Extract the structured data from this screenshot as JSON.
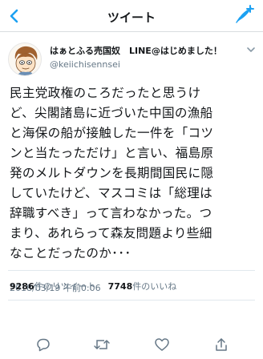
{
  "header": {
    "title": "ツイート"
  },
  "user": {
    "name": "はぁとふる売国奴　LINE@はじめました！",
    "handle": "@keiichisennsei"
  },
  "tweet": {
    "text": "民主党政権のころだったと思うけ\nど、尖閣諸島に近づいた中国の漁船\nと海保の船が接触した一件を「コツ\nンと当たっただけ」と言い、福島原\n発のメルトダウンを長期間国民に隠\nしていたけど、マスコミは「総理は\n辞職すべき」って言わなかった。つ\nまり、あれらって森友問題より些細\nなことだったのか･･･",
    "timestamp": "2018/03/19 午前0:06"
  },
  "stats": {
    "retweets_count": "9286",
    "retweets_label": "件のリツイート",
    "likes_count": "7748",
    "likes_label": "件のいいね"
  },
  "colors": {
    "accent": "#1da1f2",
    "text": "#14171a",
    "secondary": "#657786",
    "divider": "#e1e8ed"
  },
  "icons": [
    "chevron-left-icon",
    "compose-tweet-icon",
    "chevron-down-icon",
    "reply-icon",
    "retweet-icon",
    "like-icon",
    "share-icon"
  ]
}
